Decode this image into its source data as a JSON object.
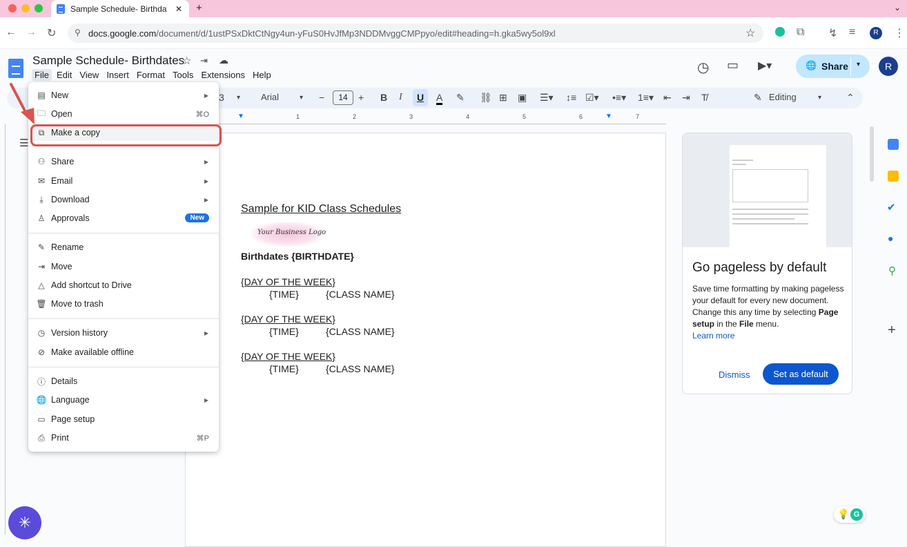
{
  "browser": {
    "tab_title": "Sample Schedule- Birthdates",
    "tab_close": "✕",
    "new_tab": "+",
    "url_host": "docs.google.com",
    "url_path": "/document/d/1ustPSxDktCtNgy4un-yFuS0HvJfMp3NDDMvggCMPpyo/edit#heading=h.gka5wy5ol9xl",
    "profile_initial": "R"
  },
  "docs": {
    "title": "Sample Schedule- Birthdates",
    "menus": [
      "File",
      "Edit",
      "View",
      "Insert",
      "Format",
      "Tools",
      "Extensions",
      "Help"
    ],
    "share_label": "Share",
    "account_initial": "R"
  },
  "toolbar": {
    "font": "Arial",
    "font_size": "14",
    "mode": "Editing",
    "partial_zoom": "3"
  },
  "ruler": [
    "1",
    "2",
    "3",
    "4",
    "5",
    "6",
    "7"
  ],
  "document": {
    "heading": "Sample for KID Class Schedules",
    "logo_text": "Your Business Logo",
    "subheading": "Birthdates {BIRTHDATE}",
    "blocks": [
      {
        "day": "{DAY OF THE WEEK}",
        "time": "{TIME}",
        "class": "{CLASS NAME}"
      },
      {
        "day": "{DAY OF THE WEEK}",
        "time": "{TIME}",
        "class": "{CLASS NAME}"
      },
      {
        "day": "{DAY OF THE WEEK}",
        "time": "{TIME}",
        "class": "{CLASS NAME}"
      }
    ]
  },
  "pageless": {
    "title": "Go pageless by default",
    "body_1": "Save time formatting by making pageless your default for every new document. Change this any time by selecting ",
    "bold_1": "Page setup",
    "body_2": " in the ",
    "bold_2": "File",
    "body_3": " menu.",
    "learn_more": "Learn more",
    "dismiss": "Dismiss",
    "set_default": "Set as default"
  },
  "file_menu": {
    "items": [
      {
        "label": "New",
        "icon": "new-doc-icon",
        "glyph": "▤",
        "submenu": true
      },
      {
        "label": "Open",
        "icon": "folder-icon",
        "glyph": "🗀",
        "shortcut": "⌘O"
      },
      {
        "label": "Make a copy",
        "icon": "copy-icon",
        "glyph": "⧉"
      },
      {
        "label": "Share",
        "icon": "person-add-icon",
        "glyph": "⚇",
        "submenu": true
      },
      {
        "label": "Email",
        "icon": "mail-icon",
        "glyph": "✉",
        "submenu": true
      },
      {
        "label": "Download",
        "icon": "download-icon",
        "glyph": "⤓",
        "submenu": true
      },
      {
        "label": "Approvals",
        "icon": "stamp-icon",
        "glyph": "♙",
        "badge": "New"
      },
      {
        "label": "Rename",
        "icon": "pencil-icon",
        "glyph": "✎"
      },
      {
        "label": "Move",
        "icon": "move-folder-icon",
        "glyph": "⇥"
      },
      {
        "label": "Add shortcut to Drive",
        "icon": "drive-shortcut-icon",
        "glyph": "△"
      },
      {
        "label": "Move to trash",
        "icon": "trash-icon",
        "glyph": "🗑"
      },
      {
        "label": "Version history",
        "icon": "history-icon",
        "glyph": "◷",
        "submenu": true
      },
      {
        "label": "Make available offline",
        "icon": "offline-icon",
        "glyph": "⊘"
      },
      {
        "label": "Details",
        "icon": "info-icon",
        "glyph": "ⓘ"
      },
      {
        "label": "Language",
        "icon": "globe-icon",
        "glyph": "🌐",
        "submenu": true
      },
      {
        "label": "Page setup",
        "icon": "page-setup-icon",
        "glyph": "▭"
      },
      {
        "label": "Print",
        "icon": "print-icon",
        "glyph": "⎙",
        "shortcut": "⌘P"
      }
    ]
  },
  "colors": {
    "tab_bar": "#f7c6dc",
    "share_button": "#c2e7ff",
    "accent_blue": "#0b57d0",
    "highlight_red": "#d9534f",
    "badge_blue": "#1a73e8"
  }
}
